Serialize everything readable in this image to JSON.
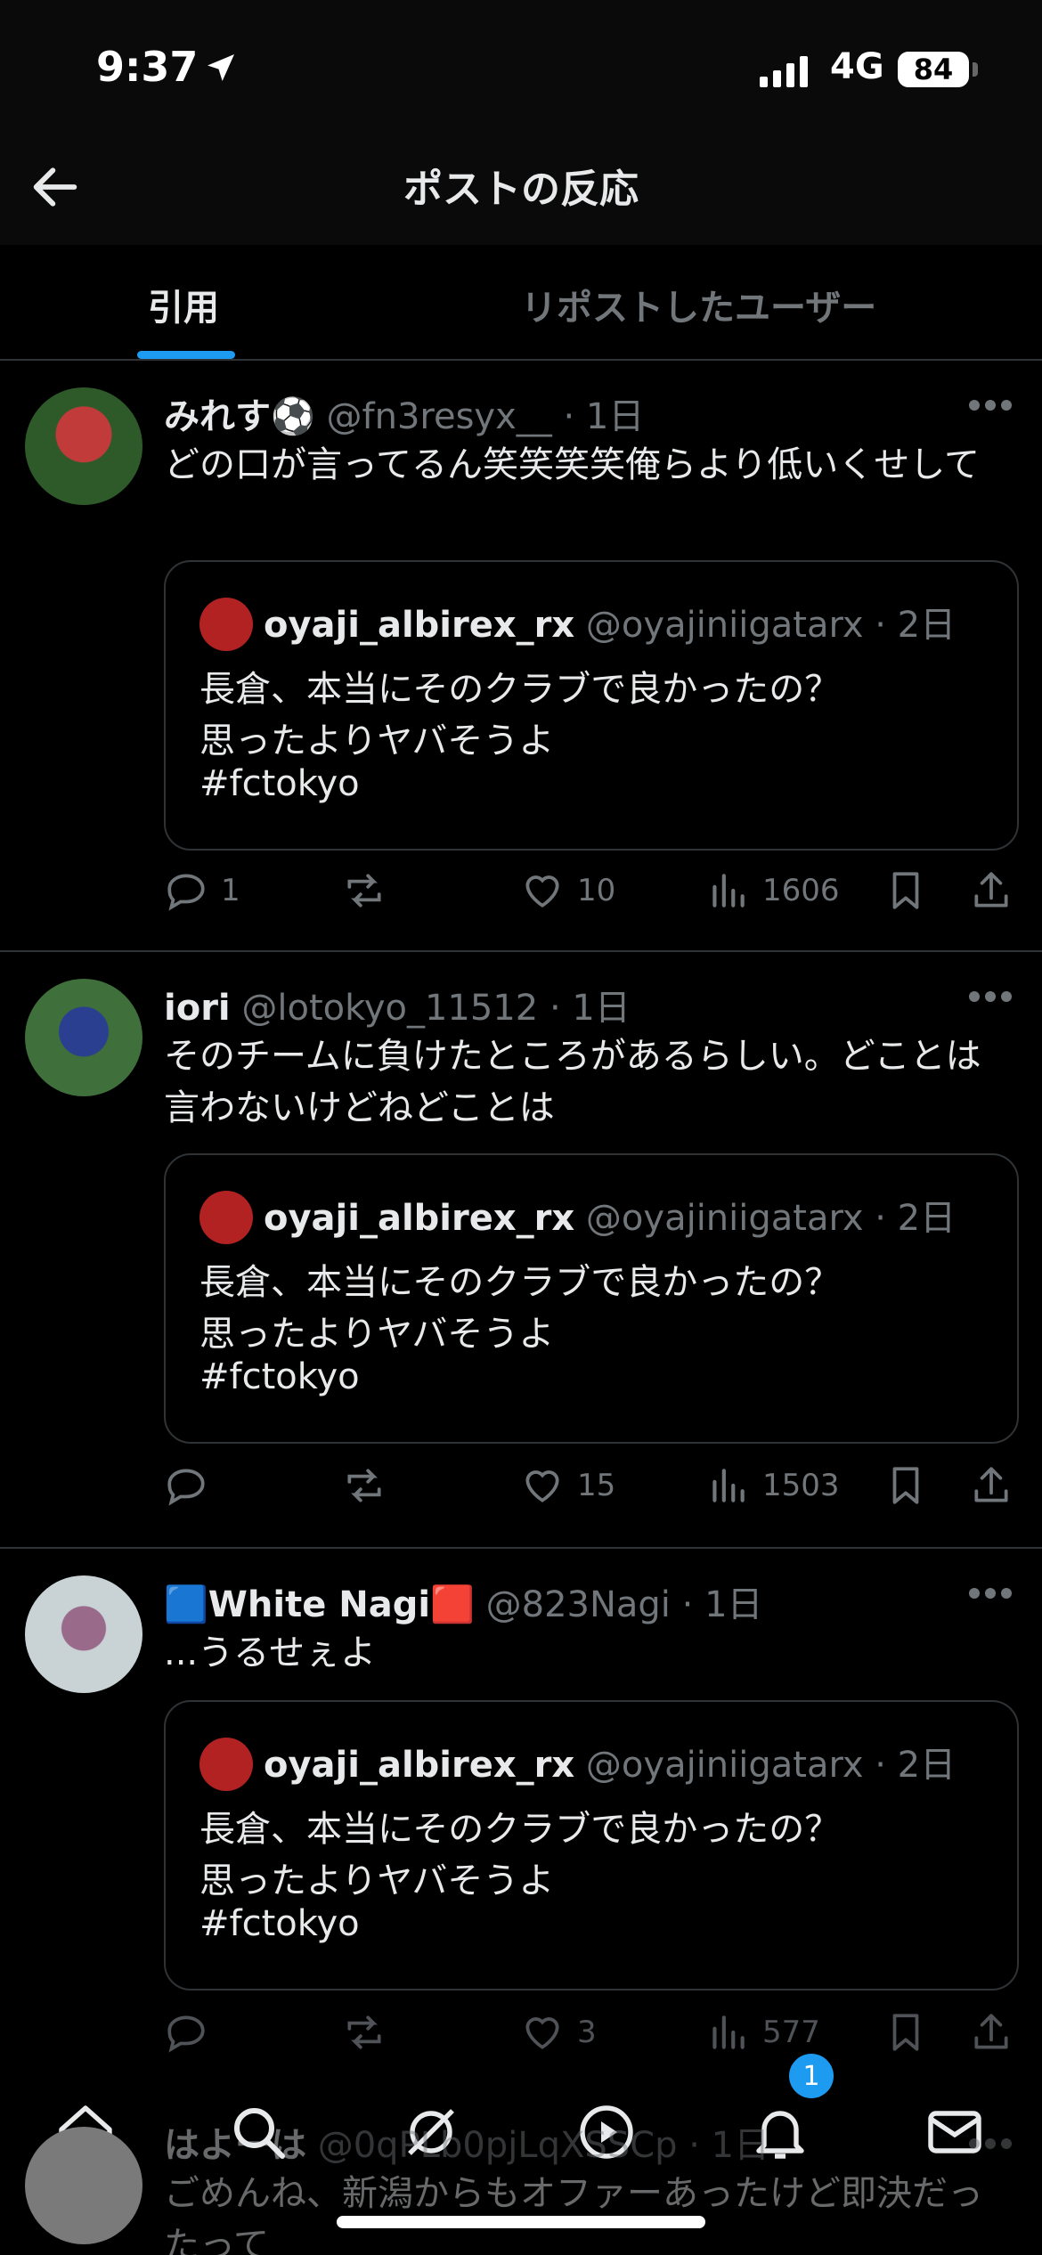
{
  "status": {
    "time": "9:37",
    "network": "4G",
    "battery": "84"
  },
  "header": {
    "title": "ポストの反応"
  },
  "tabs": [
    {
      "label": "引用"
    },
    {
      "label": "リポストしたユーザー"
    }
  ],
  "quoted": {
    "name": "oyaji_albirex_rx",
    "handle": "@oyajiniigatarx",
    "time": "· 2日",
    "lines": [
      "長倉、本当にそのクラブで良かったの？",
      "思ったよりヤバそうよ",
      "#fctokyo"
    ]
  },
  "posts": [
    {
      "name": "みれす⚽️",
      "handle": "@fn3resyx__",
      "time": "· 1日",
      "text": "どの口が言ってるん笑笑笑笑俺らより低いくせして",
      "replies": "1",
      "likes": "10",
      "views": "1606"
    },
    {
      "name": "iori",
      "handle": "@lotokyo_11512",
      "time": "· 1日",
      "text": "そのチームに負けたところがあるらしい。どことは言わないけどねどことは",
      "replies": "",
      "likes": "15",
      "views": "1503"
    },
    {
      "name": "🟦White Nagi🟥",
      "handle": "@823Nagi",
      "time": "· 1日",
      "text": "...うるせぇよ",
      "replies": "",
      "likes": "3",
      "views": "577"
    },
    {
      "name": "はよーは",
      "handle": "@0qPLb0pjLqXSSCp",
      "time": "· 1日",
      "text": "ごめんね、新潟からもオファーあったけど即決だったって"
    }
  ],
  "nav": {
    "notifications_badge": "1"
  },
  "icons": [
    "back-arrow-icon",
    "more-icon",
    "reply-icon",
    "repost-icon",
    "like-icon",
    "views-icon",
    "bookmark-icon",
    "share-icon",
    "home-icon",
    "search-icon",
    "grok-icon",
    "video-icon",
    "bell-icon",
    "mail-icon"
  ],
  "colors": {
    "accent": "#1d9bf0",
    "muted": "#71767b",
    "text": "#e7e9ea",
    "divider": "#2f3336"
  }
}
